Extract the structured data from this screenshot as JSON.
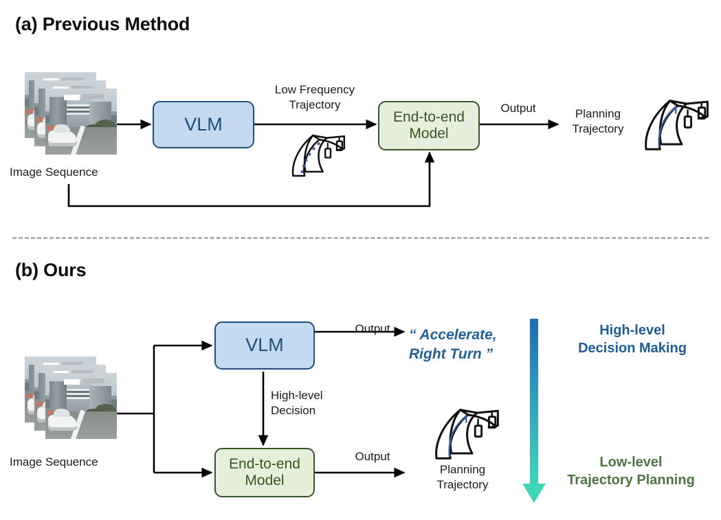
{
  "sections": [
    {
      "id": "a",
      "title": "(a) Previous Method",
      "image_sequence_label": "Image Sequence",
      "vlm_label": "VLM",
      "e2e_label": "End-to-end\nModel",
      "edge_low_freq": "Low Frequency\nTrajectory",
      "edge_output": "Output",
      "planning_label": "Planning\nTrajectory",
      "icons": [
        "road-dotted-trajectory-icon",
        "road-arrow-trajectory-icon"
      ]
    },
    {
      "id": "b",
      "title": "(b) Ours",
      "image_sequence_label": "Image Sequence",
      "vlm_label": "VLM",
      "e2e_label": "End-to-end\nModel",
      "edge_high_level": "High-level\nDecision",
      "edge_output_top": "Output",
      "edge_output_bottom": "Output",
      "vlm_output_quote": "“ Accelerate,\nRight Turn ”",
      "planning_label": "Planning\nTrajectory",
      "stage_high": "High-level\nDecision Making",
      "stage_low": "Low-level\nTrajectory Planning",
      "icons": [
        "road-arrow-trajectory-icon",
        "gradient-down-arrow-icon"
      ]
    }
  ],
  "colors": {
    "vlm_fill": "#c5d9f1",
    "vlm_border": "#1f4e79",
    "vlm_text": "#1f4e79",
    "e2e_fill": "#e6efdc",
    "e2e_border": "#375623",
    "e2e_text": "#375623",
    "quote_text": "#1f6198",
    "stage_high_text": "#1f5c96",
    "stage_low_text": "#4e7540",
    "gradient_top": "#1f6cb4",
    "gradient_bottom": "#3fd6b8",
    "divider": "#b0b0b0",
    "arrow": "#000000",
    "trajectory_blue": "#3a5f9e",
    "body_text": "#1a1a1a",
    "title_text": "#0d0d0d"
  }
}
